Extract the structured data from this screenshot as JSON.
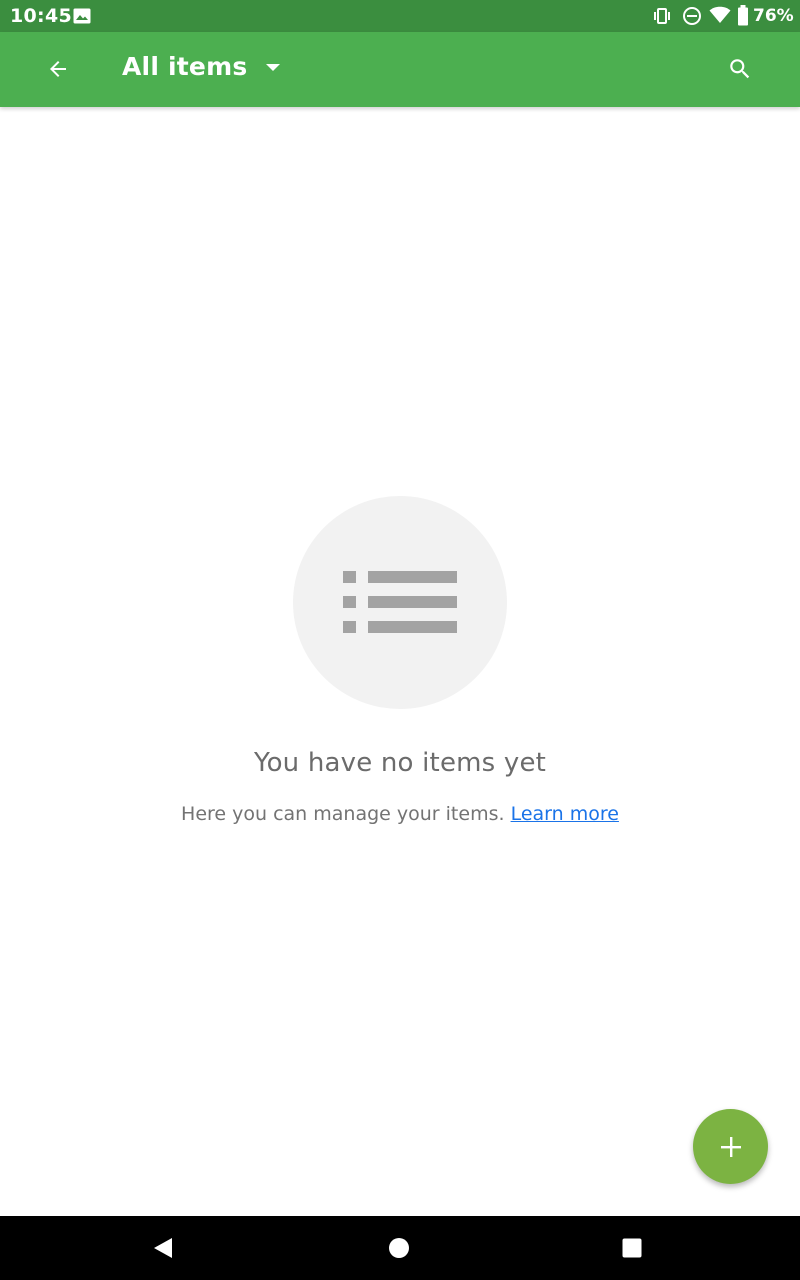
{
  "status_bar": {
    "time": "10:45",
    "battery_percent": "76%",
    "icons": [
      "image-notification-icon",
      "vibrate-icon",
      "do-not-disturb-icon",
      "wifi-icon",
      "battery-icon"
    ]
  },
  "app_bar": {
    "title": "All items",
    "back_icon": "arrow-back-icon",
    "dropdown_icon": "arrow-drop-down-icon",
    "search_icon": "search-icon"
  },
  "empty_state": {
    "icon": "list-icon",
    "title": "You have no items yet",
    "description": "Here you can manage your items.",
    "link_text": "Learn more"
  },
  "fab": {
    "icon": "plus-icon"
  },
  "nav_bar": {
    "icons": [
      "back-triangle-icon",
      "home-circle-icon",
      "recents-square-icon"
    ]
  },
  "colors": {
    "status_bar": "#3b8e3f",
    "app_bar": "#4caf50",
    "fab": "#7cb342",
    "link": "#1a73e8",
    "empty_circle": "#f2f2f2",
    "list_icon": "#a3a3a3"
  }
}
